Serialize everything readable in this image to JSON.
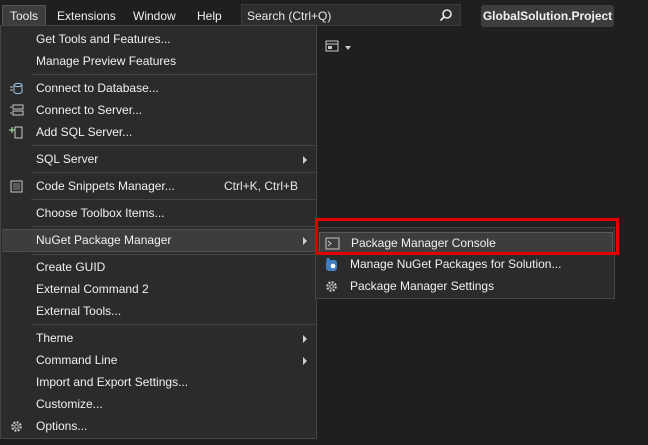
{
  "menubar": {
    "items": [
      "Tools",
      "Extensions",
      "Window",
      "Help"
    ],
    "search_text": "Search (Ctrl+Q)",
    "project": "GlobalSolution.Project"
  },
  "tools_menu": {
    "items": [
      {
        "label": "Get Tools and Features..."
      },
      {
        "label": "Manage Preview Features"
      },
      {
        "label": "Connect to Database...",
        "icon": "database-connect-icon"
      },
      {
        "label": "Connect to Server...",
        "icon": "server-connect-icon"
      },
      {
        "label": "Add SQL Server...",
        "icon": "add-sql-server-icon"
      },
      {
        "label": "SQL Server",
        "submenu": true
      },
      {
        "label": "Code Snippets Manager...",
        "shortcut": "Ctrl+K, Ctrl+B",
        "icon": "snippet-icon"
      },
      {
        "label": "Choose Toolbox Items..."
      },
      {
        "label": "NuGet Package Manager",
        "submenu": true
      },
      {
        "label": "Create GUID"
      },
      {
        "label": "External Command 2"
      },
      {
        "label": "External Tools..."
      },
      {
        "label": "Theme",
        "submenu": true
      },
      {
        "label": "Command Line",
        "submenu": true
      },
      {
        "label": "Import and Export Settings..."
      },
      {
        "label": "Customize..."
      },
      {
        "label": "Options...",
        "icon": "gear-icon"
      }
    ]
  },
  "nuget_submenu": {
    "items": [
      {
        "label": "Package Manager Console",
        "icon": "console-icon"
      },
      {
        "label": "Manage NuGet Packages for Solution...",
        "icon": "nuget-icon"
      },
      {
        "label": "Package Manager Settings",
        "icon": "gear-icon"
      }
    ]
  },
  "colors": {
    "background": "#1f1f1f",
    "menu_bg": "#2b2b2b",
    "hover_bg": "#3d3d3d",
    "callout_red": "#e00000"
  }
}
